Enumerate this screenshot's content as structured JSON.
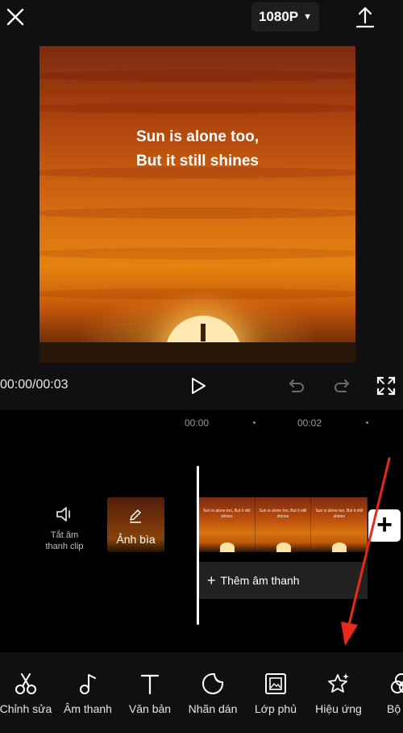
{
  "header": {
    "resolution_label": "1080P",
    "close_icon": "close-icon",
    "export_icon": "export-icon"
  },
  "preview": {
    "caption_line1": "Sun is alone too,",
    "caption_line2": "But it still shines"
  },
  "playback": {
    "timecode": "00:00/00:03",
    "icons": [
      "play-icon",
      "undo-icon",
      "redo-icon",
      "fullscreen-icon"
    ]
  },
  "timeline": {
    "ruler": [
      "00:00",
      "00:02"
    ],
    "mute_clip_label_line1": "Tắt âm",
    "mute_clip_label_line2": "thanh clip",
    "cover_label": "Ảnh bìa",
    "add_audio_label": "Thêm âm thanh",
    "add_clip_symbol": "+",
    "frame_caption": "Sun is alone too, But it still shines"
  },
  "toolbar": {
    "items": [
      {
        "label": "Chỉnh sửa",
        "icon": "scissors-icon"
      },
      {
        "label": "Âm thanh",
        "icon": "music-note-icon"
      },
      {
        "label": "Văn bản",
        "icon": "text-icon"
      },
      {
        "label": "Nhãn dán",
        "icon": "sticker-icon"
      },
      {
        "label": "Lớp phủ",
        "icon": "overlay-icon"
      },
      {
        "label": "Hiệu ứng",
        "icon": "sparkle-star-icon"
      },
      {
        "label": "Bộ",
        "icon": "filter-icon"
      }
    ]
  },
  "colors": {
    "background": "#101010",
    "timeline_background": "#000000",
    "annotation_arrow": "#e8291c"
  }
}
